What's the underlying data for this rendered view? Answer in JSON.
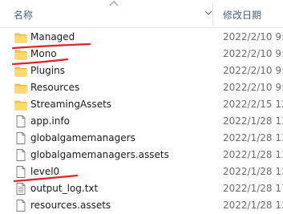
{
  "header": {
    "name_label": "名称",
    "date_label": "修改日期"
  },
  "files": [
    {
      "name": "Managed",
      "type": "folder",
      "date": "2022/2/10 9:4"
    },
    {
      "name": "Mono",
      "type": "folder",
      "date": "2022/2/10 9:4"
    },
    {
      "name": "Plugins",
      "type": "folder",
      "date": "2022/2/10 9:4"
    },
    {
      "name": "Resources",
      "type": "folder",
      "date": "2022/2/10 9:4"
    },
    {
      "name": "StreamingAssets",
      "type": "folder",
      "date": "2022/2/15 12"
    },
    {
      "name": "app.info",
      "type": "file",
      "date": "2022/1/28 13"
    },
    {
      "name": "globalgamemanagers",
      "type": "file",
      "date": "2022/1/28 13"
    },
    {
      "name": "globalgamemanagers.assets",
      "type": "file",
      "date": "2022/1/28 13"
    },
    {
      "name": "level0",
      "type": "file",
      "date": "2022/1/28 13"
    },
    {
      "name": "output_log.txt",
      "type": "file-lines",
      "date": "2022/1/28 17"
    },
    {
      "name": "resources.assets",
      "type": "file",
      "date": "2022/1/28 13"
    }
  ],
  "annotation_color": "#e0202a"
}
